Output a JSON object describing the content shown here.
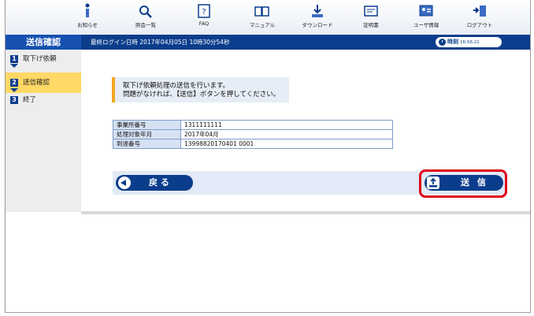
{
  "toolbar": {
    "items": [
      {
        "label": "お知らせ",
        "icon": "info-icon"
      },
      {
        "label": "照会一覧",
        "icon": "search-icon"
      },
      {
        "label": "FAQ",
        "icon": "faq-icon"
      },
      {
        "label": "マニュアル",
        "icon": "manual-icon"
      },
      {
        "label": "ダウンロード",
        "icon": "download-icon"
      },
      {
        "label": "証明書",
        "icon": "certificate-icon"
      },
      {
        "label": "ユーザ情報",
        "icon": "user-info-icon"
      },
      {
        "label": "ログアウト",
        "icon": "logout-icon"
      }
    ]
  },
  "header": {
    "title": "送信確認",
    "last_login": "最終ログイン日時 2017年04月05日 10時30分54秒",
    "clock_label": "時刻",
    "clock_time": "16:56:21"
  },
  "sidebar": {
    "steps": [
      {
        "num": "1",
        "label": "取下げ依頼"
      },
      {
        "num": "2",
        "label": "送信確認"
      },
      {
        "num": "3",
        "label": "終了"
      }
    ]
  },
  "main": {
    "message_line1": "取下げ依頼処理の送信を行います。",
    "message_line2": "問題がなければ、【送信】ボタンを押してください。",
    "details": [
      {
        "key": "事業所番号",
        "value": "1311111111"
      },
      {
        "key": "処理対象年月",
        "value": "2017年04月"
      },
      {
        "key": "到達番号",
        "value": "13998820170401 0001"
      }
    ],
    "back_label": "戻 る",
    "send_label": "送 信"
  },
  "colors": {
    "navy": "#0b3d8c",
    "accent_orange": "#f5a623",
    "highlight_red": "#e0001b",
    "active_step": "#ffd866"
  }
}
